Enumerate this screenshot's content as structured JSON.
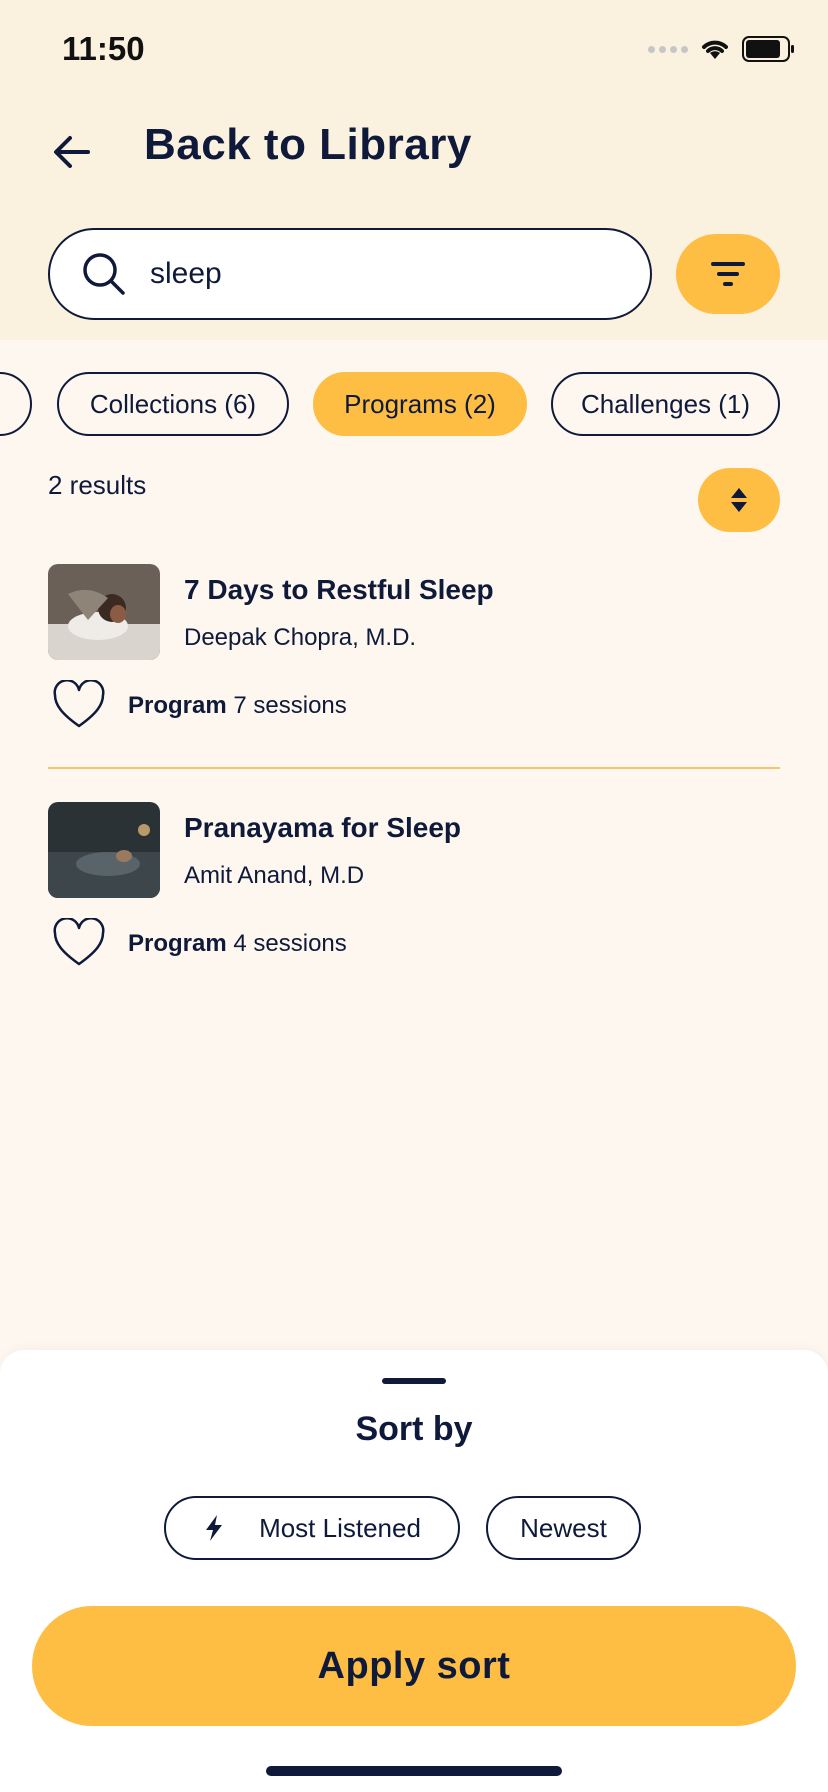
{
  "status_bar": {
    "time": "11:50"
  },
  "header": {
    "title": "Back to Library"
  },
  "search": {
    "value": "sleep",
    "placeholder": ""
  },
  "chips": [
    {
      "label": "Collections (6)",
      "active": false
    },
    {
      "label": "Programs (2)",
      "active": true
    },
    {
      "label": "Challenges (1)",
      "active": false
    }
  ],
  "results_count": "2 results",
  "items": [
    {
      "title": "7 Days to Restful Sleep",
      "author": "Deepak Chopra, M.D.",
      "type": "Program",
      "sessions": "7 sessions"
    },
    {
      "title": "Pranayama for Sleep",
      "author": "Amit Anand, M.D",
      "type": "Program",
      "sessions": "4 sessions"
    }
  ],
  "sort_sheet": {
    "title": "Sort by",
    "options": [
      {
        "label": "Most Listened",
        "icon": "lightning-icon"
      },
      {
        "label": "Newest"
      }
    ],
    "apply_label": "Apply sort"
  },
  "colors": {
    "accent": "#fdbe43",
    "ink": "#0f1a3a",
    "header_bg": "#fbf1df",
    "page_bg": "#fef7f0"
  }
}
